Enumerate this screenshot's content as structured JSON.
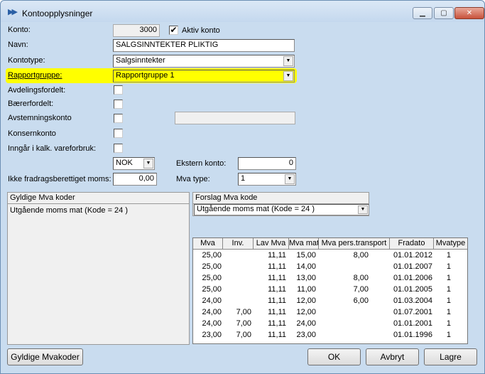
{
  "window": {
    "title": "Kontoopplysninger",
    "minimize": "▁",
    "maximize": "▢",
    "close": "✕"
  },
  "form": {
    "konto_label": "Konto:",
    "konto_value": "3000",
    "aktiv_label": "Aktiv konto",
    "aktiv_checked": "✔",
    "navn_label": "Navn:",
    "navn_value": "SALGSINNTEKTER PLIKTIG",
    "kontotype_label": "Kontotype:",
    "kontotype_value": "Salgsinntekter",
    "rapportgruppe_label": "Rapportgruppe:",
    "rapportgruppe_value": "Rapportgruppe 1",
    "avdeling_label": "Avdelingsfordelt:",
    "baerer_label": "Bærerfordelt:",
    "avstemming_label": "Avstemningskonto",
    "konsern_label": "Konsernkonto",
    "inngar_label": "Inngår i kalk. vareforbruk:",
    "currency_value": "NOK",
    "ekstern_label": "Ekstern konto:",
    "ekstern_value": "0",
    "ikke_frad_label": "Ikke fradragsberettiget moms:",
    "ikke_frad_value": "0,00",
    "mva_type_label": "Mva type:",
    "mva_type_value": "1"
  },
  "gyldige": {
    "title": "Gyldige Mva koder",
    "items": [
      "Utgående moms mat   (Kode = 24 )"
    ]
  },
  "forslag": {
    "title": "Forslag Mva kode",
    "value": "Utgående moms mat   (Kode = 24 )"
  },
  "table": {
    "headers": [
      "Mva",
      "Inv.",
      "Lav Mva",
      "Mva mat",
      "Mva pers.transport",
      "Fradato",
      "Mvatype"
    ],
    "rows": [
      [
        "25,00",
        "",
        "11,11",
        "15,00",
        "8,00",
        "01.01.2012",
        "1"
      ],
      [
        "25,00",
        "",
        "11,11",
        "14,00",
        "",
        "01.01.2007",
        "1"
      ],
      [
        "25,00",
        "",
        "11,11",
        "13,00",
        "8,00",
        "01.01.2006",
        "1"
      ],
      [
        "25,00",
        "",
        "11,11",
        "11,00",
        "7,00",
        "01.01.2005",
        "1"
      ],
      [
        "24,00",
        "",
        "11,11",
        "12,00",
        "6,00",
        "01.03.2004",
        "1"
      ],
      [
        "24,00",
        "7,00",
        "11,11",
        "12,00",
        "",
        "01.07.2001",
        "1"
      ],
      [
        "24,00",
        "7,00",
        "11,11",
        "24,00",
        "",
        "01.01.2001",
        "1"
      ],
      [
        "23,00",
        "7,00",
        "11,11",
        "23,00",
        "",
        "01.01.1996",
        "1"
      ]
    ]
  },
  "buttons": {
    "gyldige": "Gyldige Mvakoder",
    "ok": "OK",
    "avbryt": "Avbryt",
    "lagre": "Lagre"
  },
  "colors": {
    "highlight": "#ffff00",
    "title_bar": "#c4d8ee"
  }
}
